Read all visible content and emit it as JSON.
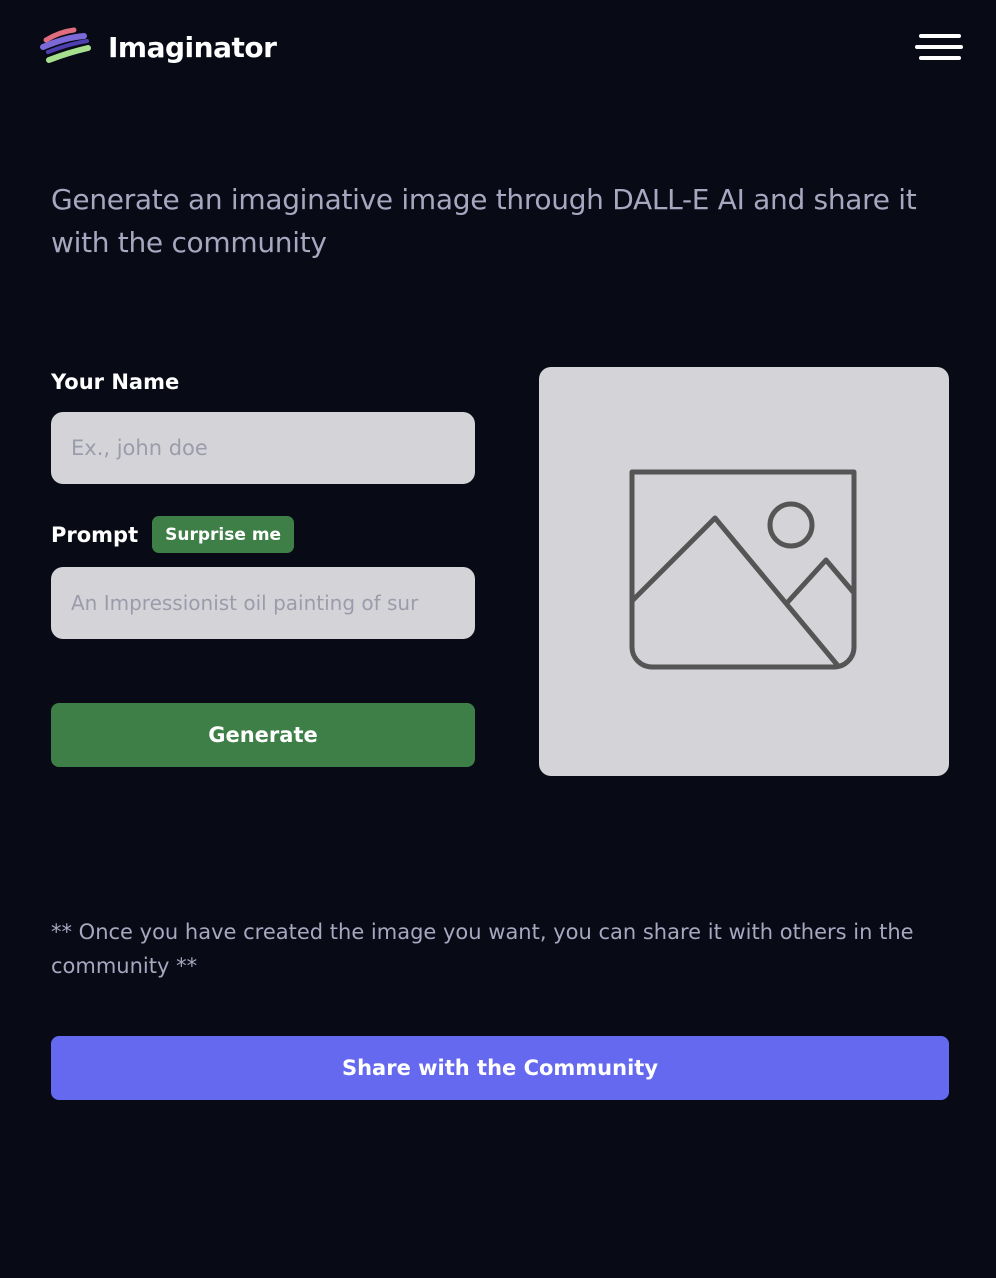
{
  "header": {
    "app_name": "Imaginator",
    "logo_icon": "paint-strokes-logo",
    "menu_icon": "hamburger-menu-icon"
  },
  "intro": {
    "text": "Generate an imaginative image through DALL-E AI and share it with the community"
  },
  "form": {
    "name_label": "Your Name",
    "name_placeholder": "Ex., john doe",
    "name_value": "",
    "prompt_label": "Prompt",
    "surprise_label": "Surprise me",
    "prompt_placeholder": "An Impressionist oil painting of sur",
    "prompt_value": "",
    "generate_label": "Generate"
  },
  "preview": {
    "placeholder_icon": "image-placeholder-icon"
  },
  "footer": {
    "note": "** Once you have created the image you want, you can share it with others in the community **",
    "share_label": "Share with the Community"
  },
  "colors": {
    "background": "#080a16",
    "accent_green": "#3d7f47",
    "accent_purple": "#6469ef",
    "input_bg": "#d4d4d8",
    "muted_text": "#a7a7c0"
  }
}
